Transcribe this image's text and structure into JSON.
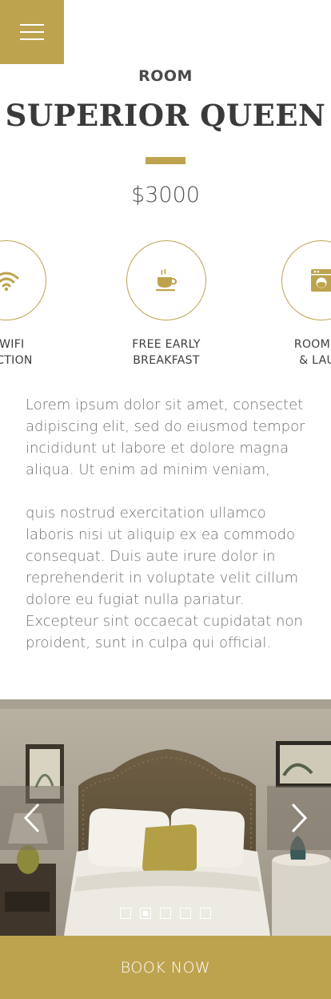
{
  "header": {
    "menu_icon": "hamburger-icon",
    "room_label": "ROOM",
    "room_title": "SUPERIOR QUEEN",
    "price": "$3000"
  },
  "amenities": [
    {
      "icon": "wifi-icon",
      "line1": "T WIFI",
      "line2": "NECTION"
    },
    {
      "icon": "coffee-cup-icon",
      "line1": "FREE EARLY",
      "line2": "BREAKFAST"
    },
    {
      "icon": "washing-machine-icon",
      "line1": "ROOM SE",
      "line2": "& LAUN"
    }
  ],
  "description": {
    "paragraph1": "Lorem ipsum dolor sit amet, consectet  adipiscing elit, sed do eiusmod tempor incididunt ut labore et dolore magna aliqua. Ut enim ad minim veniam,",
    "paragraph2": "quis nostrud exercitation ullamco laboris nisi ut aliquip ex ea commodo consequat. Duis aute irure dolor in reprehenderit in voluptate velit cillum dolore eu fugiat nulla pariatur. Excepteur sint occaecat cupidatat non proident, sunt in culpa qui official."
  },
  "slider": {
    "image": "bedroom-photo",
    "prev_icon": "chevron-left-icon",
    "next_icon": "chevron-right-icon",
    "dot_count": 5,
    "active_dot": 2
  },
  "cta": {
    "book_label": "BOOK NOW"
  },
  "colors": {
    "accent": "#bea34f",
    "text_dark": "#3a3a3a",
    "text_body": "#707070"
  }
}
